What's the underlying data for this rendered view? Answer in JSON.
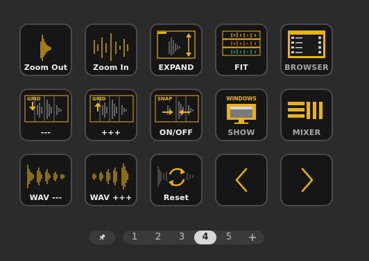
{
  "colors": {
    "accent": "#e8b21a",
    "key_bg": "#161616",
    "key_border": "#4a4a4a",
    "background": "#2b2b2b"
  },
  "keys": [
    {
      "label": "Zoom Out",
      "icon": "zoom-out-waveform-icon"
    },
    {
      "label": "Zoom In",
      "icon": "zoom-in-waveform-icon"
    },
    {
      "label": "EXPAND",
      "icon": "expand-vertical-icon"
    },
    {
      "label": "FIT",
      "icon": "fit-tracks-icon"
    },
    {
      "label": "BROWSER",
      "icon": "browser-list-icon"
    },
    {
      "label": "---",
      "icon": "grid-decrease-icon",
      "icon_text": "GRID"
    },
    {
      "label": "+++",
      "icon": "grid-increase-icon",
      "icon_text": "GRID"
    },
    {
      "label": "ON/OFF",
      "icon": "snap-toggle-icon",
      "icon_text": "SNAP"
    },
    {
      "label": "SHOW",
      "icon": "windows-show-icon",
      "icon_text": "WINDOWS"
    },
    {
      "label": "MIXER",
      "icon": "mixer-bars-icon"
    },
    {
      "label": "WAV ---",
      "icon": "wave-zoom-out-icon"
    },
    {
      "label": "WAV +++",
      "icon": "wave-zoom-in-icon"
    },
    {
      "label": "Reset",
      "icon": "reset-refresh-icon"
    },
    {
      "label": "",
      "icon": "chevron-left-icon"
    },
    {
      "label": "",
      "icon": "chevron-right-icon"
    }
  ],
  "pager": {
    "pin_icon": "pin-icon",
    "pages": [
      "1",
      "2",
      "3",
      "4",
      "5"
    ],
    "active_page": "4",
    "add_icon": "plus-icon"
  }
}
